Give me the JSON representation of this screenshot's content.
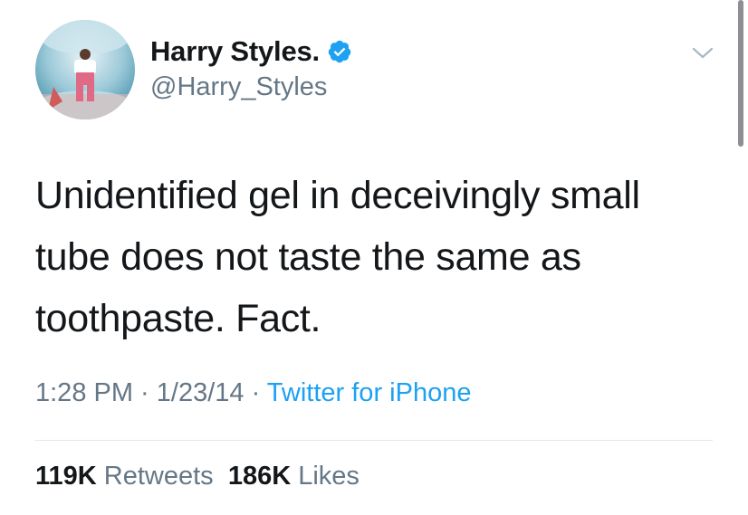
{
  "user": {
    "display_name": "Harry Styles.",
    "handle": "@Harry_Styles",
    "verified": true
  },
  "icons": {
    "avatar": "profile-photo",
    "verified": "verified-badge-icon",
    "menu": "chevron-down-icon"
  },
  "tweet": {
    "text": "Unidentified gel in deceivingly small tube does not taste the same as toothpaste. Fact."
  },
  "meta": {
    "time": "1:28 PM",
    "separator": " · ",
    "date": "1/23/14",
    "source": "Twitter for iPhone"
  },
  "stats": {
    "retweets_count": "119K",
    "retweets_label": "Retweets",
    "likes_count": "186K",
    "likes_label": "Likes"
  },
  "colors": {
    "text": "#14171a",
    "secondary": "#657786",
    "accent": "#1da1f2",
    "divider": "#e1e8ed"
  }
}
